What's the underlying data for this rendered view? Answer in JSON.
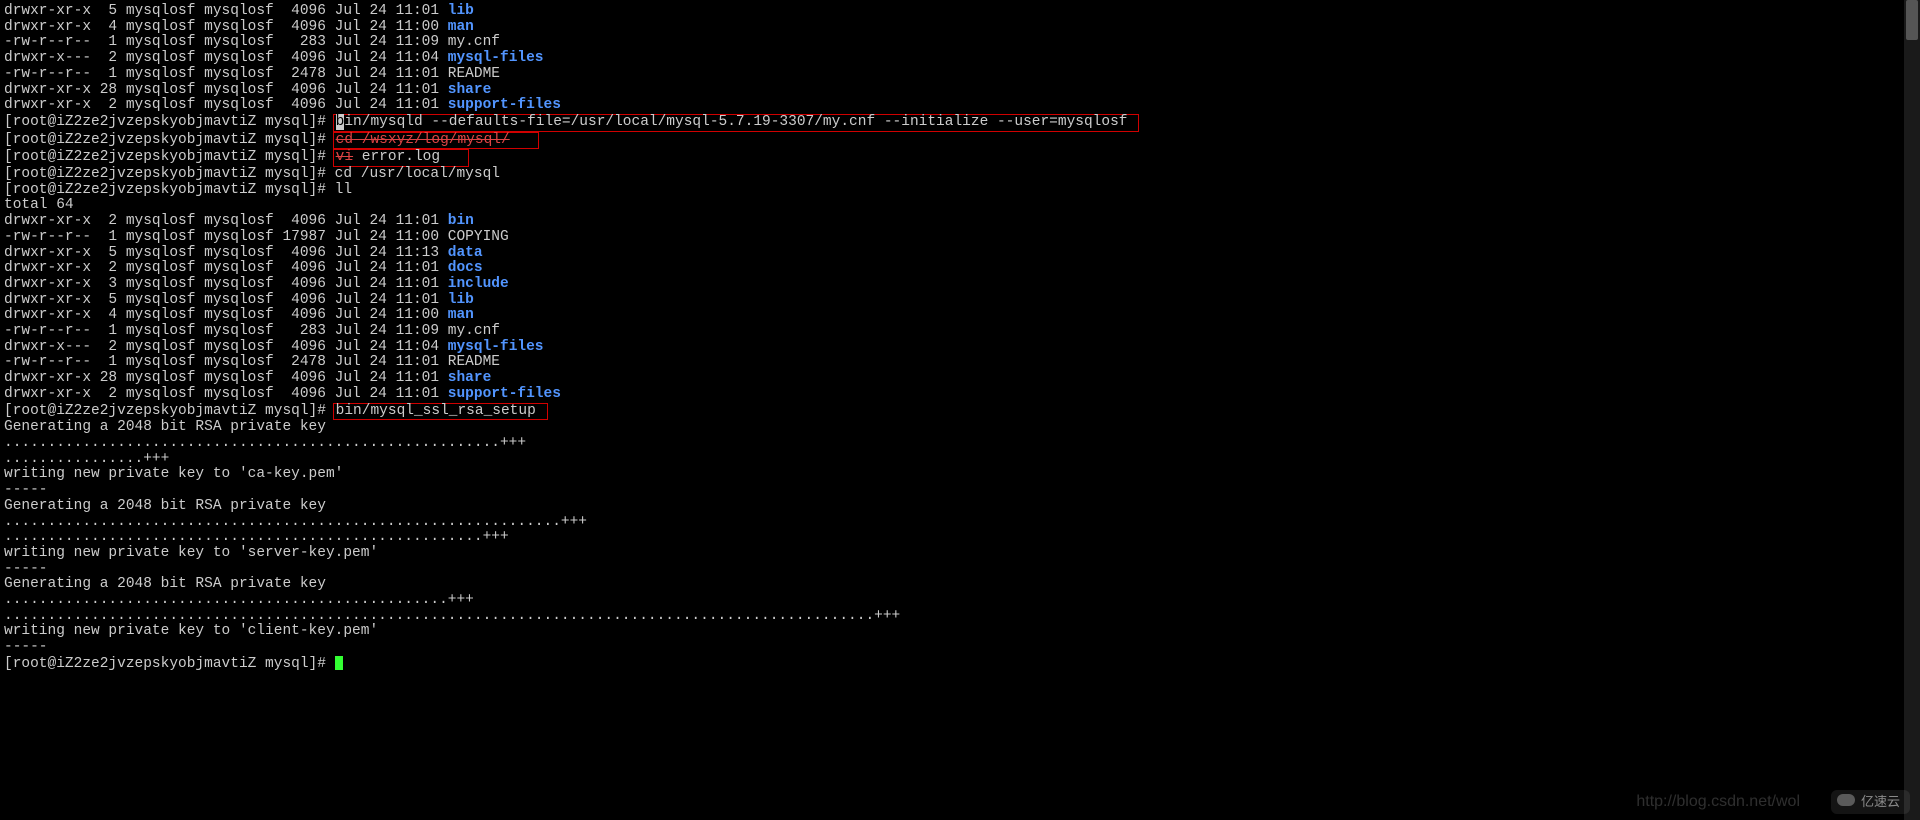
{
  "ls1": [
    {
      "perm": "drwxr-xr-x",
      "n": "5",
      "o": "mysqlosf",
      "g": "mysqlosf",
      "sz": "4096",
      "dt": "Jul 24 11:01",
      "name": "lib",
      "blue": true
    },
    {
      "perm": "drwxr-xr-x",
      "n": "4",
      "o": "mysqlosf",
      "g": "mysqlosf",
      "sz": "4096",
      "dt": "Jul 24 11:00",
      "name": "man",
      "blue": true
    },
    {
      "perm": "-rw-r--r--",
      "n": "1",
      "o": "mysqlosf",
      "g": "mysqlosf",
      "sz": "283",
      "dt": "Jul 24 11:09",
      "name": "my.cnf",
      "blue": false
    },
    {
      "perm": "drwxr-x---",
      "n": "2",
      "o": "mysqlosf",
      "g": "mysqlosf",
      "sz": "4096",
      "dt": "Jul 24 11:04",
      "name": "mysql-files",
      "blue": true
    },
    {
      "perm": "-rw-r--r--",
      "n": "1",
      "o": "mysqlosf",
      "g": "mysqlosf",
      "sz": "2478",
      "dt": "Jul 24 11:01",
      "name": "README",
      "blue": false
    },
    {
      "perm": "drwxr-xr-x",
      "n": "28",
      "o": "mysqlosf",
      "g": "mysqlosf",
      "sz": "4096",
      "dt": "Jul 24 11:01",
      "name": "share",
      "blue": true
    },
    {
      "perm": "drwxr-xr-x",
      "n": "2",
      "o": "mysqlosf",
      "g": "mysqlosf",
      "sz": "4096",
      "dt": "Jul 24 11:01",
      "name": "support-files",
      "blue": true
    }
  ],
  "prompt": "[root@iZ2ze2jvzepskyobjmavtiZ mysql]# ",
  "cmd1_pre": "b",
  "cmd1": "in/mysqld --defaults-file=/usr/local/mysql-5.7.19-3307/my.cnf --initialize --user=mysqlosf",
  "cmd2_pre": "cd",
  "cmd2_post": " /wsxyz/log/mysql/",
  "cmd3_pre": "vi",
  "cmd3_post": " error.log",
  "cmd4": "cd /usr/local/mysql",
  "cmd5": "ll",
  "total": "total 64",
  "ls2": [
    {
      "perm": "drwxr-xr-x",
      "n": "2",
      "o": "mysqlosf",
      "g": "mysqlosf",
      "sz": "4096",
      "dt": "Jul 24 11:01",
      "name": "bin",
      "blue": true
    },
    {
      "perm": "-rw-r--r--",
      "n": "1",
      "o": "mysqlosf",
      "g": "mysqlosf",
      "sz": "17987",
      "dt": "Jul 24 11:00",
      "name": "COPYING",
      "blue": false
    },
    {
      "perm": "drwxr-xr-x",
      "n": "5",
      "o": "mysqlosf",
      "g": "mysqlosf",
      "sz": "4096",
      "dt": "Jul 24 11:13",
      "name": "data",
      "blue": true
    },
    {
      "perm": "drwxr-xr-x",
      "n": "2",
      "o": "mysqlosf",
      "g": "mysqlosf",
      "sz": "4096",
      "dt": "Jul 24 11:01",
      "name": "docs",
      "blue": true
    },
    {
      "perm": "drwxr-xr-x",
      "n": "3",
      "o": "mysqlosf",
      "g": "mysqlosf",
      "sz": "4096",
      "dt": "Jul 24 11:01",
      "name": "include",
      "blue": true
    },
    {
      "perm": "drwxr-xr-x",
      "n": "5",
      "o": "mysqlosf",
      "g": "mysqlosf",
      "sz": "4096",
      "dt": "Jul 24 11:01",
      "name": "lib",
      "blue": true
    },
    {
      "perm": "drwxr-xr-x",
      "n": "4",
      "o": "mysqlosf",
      "g": "mysqlosf",
      "sz": "4096",
      "dt": "Jul 24 11:00",
      "name": "man",
      "blue": true
    },
    {
      "perm": "-rw-r--r--",
      "n": "1",
      "o": "mysqlosf",
      "g": "mysqlosf",
      "sz": "283",
      "dt": "Jul 24 11:09",
      "name": "my.cnf",
      "blue": false
    },
    {
      "perm": "drwxr-x---",
      "n": "2",
      "o": "mysqlosf",
      "g": "mysqlosf",
      "sz": "4096",
      "dt": "Jul 24 11:04",
      "name": "mysql-files",
      "blue": true
    },
    {
      "perm": "-rw-r--r--",
      "n": "1",
      "o": "mysqlosf",
      "g": "mysqlosf",
      "sz": "2478",
      "dt": "Jul 24 11:01",
      "name": "README",
      "blue": false
    },
    {
      "perm": "drwxr-xr-x",
      "n": "28",
      "o": "mysqlosf",
      "g": "mysqlosf",
      "sz": "4096",
      "dt": "Jul 24 11:01",
      "name": "share",
      "blue": true
    },
    {
      "perm": "drwxr-xr-x",
      "n": "2",
      "o": "mysqlosf",
      "g": "mysqlosf",
      "sz": "4096",
      "dt": "Jul 24 11:01",
      "name": "support-files",
      "blue": true
    }
  ],
  "cmd6": "bin/mysql_ssl_rsa_setup",
  "ssl": [
    "Generating a 2048 bit RSA private key",
    ".........................................................+++",
    "................+++",
    "writing new private key to 'ca-key.pem'",
    "-----",
    "Generating a 2048 bit RSA private key",
    "................................................................+++",
    ".......................................................+++",
    "writing new private key to 'server-key.pem'",
    "-----",
    "Generating a 2048 bit RSA private key",
    "...................................................+++",
    "....................................................................................................+++",
    "writing new private key to 'client-key.pem'",
    "-----"
  ],
  "wm1": "http://blog.csdn.net/wol",
  "wm2": "亿速云"
}
